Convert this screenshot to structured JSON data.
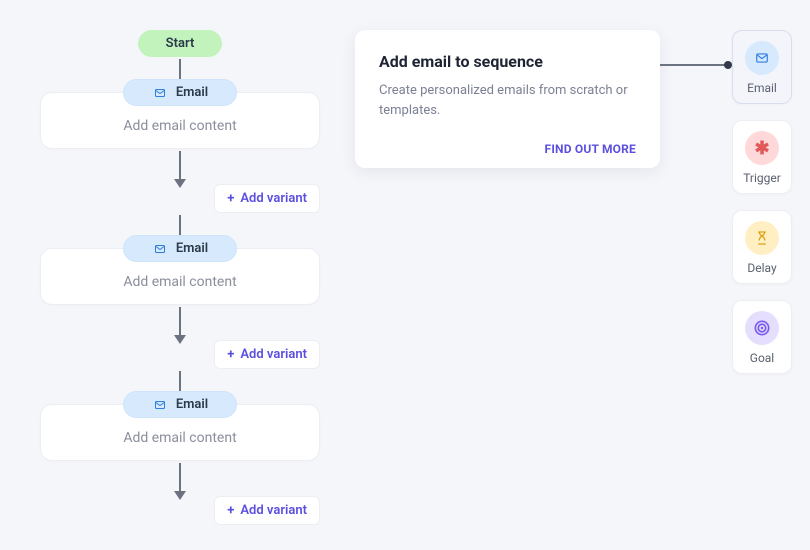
{
  "flow": {
    "start_label": "Start",
    "nodes": [
      {
        "label": "Email",
        "body": "Add email content",
        "variant_btn": "Add variant"
      },
      {
        "label": "Email",
        "body": "Add email content",
        "variant_btn": "Add variant"
      },
      {
        "label": "Email",
        "body": "Add email content",
        "variant_btn": "Add variant"
      }
    ]
  },
  "info_card": {
    "title": "Add email to sequence",
    "body": "Create personalized emails from scratch or templates.",
    "link": "FIND OUT MORE"
  },
  "palette": {
    "items": [
      {
        "label": "Email",
        "icon": "email",
        "active": true
      },
      {
        "label": "Trigger",
        "icon": "trigger",
        "active": false
      },
      {
        "label": "Delay",
        "icon": "delay",
        "active": false
      },
      {
        "label": "Goal",
        "icon": "goal",
        "active": false
      }
    ]
  },
  "colors": {
    "accent": "#5b4fe0",
    "email_bg": "#d6e9fd",
    "start_bg": "#c3f3bd"
  }
}
